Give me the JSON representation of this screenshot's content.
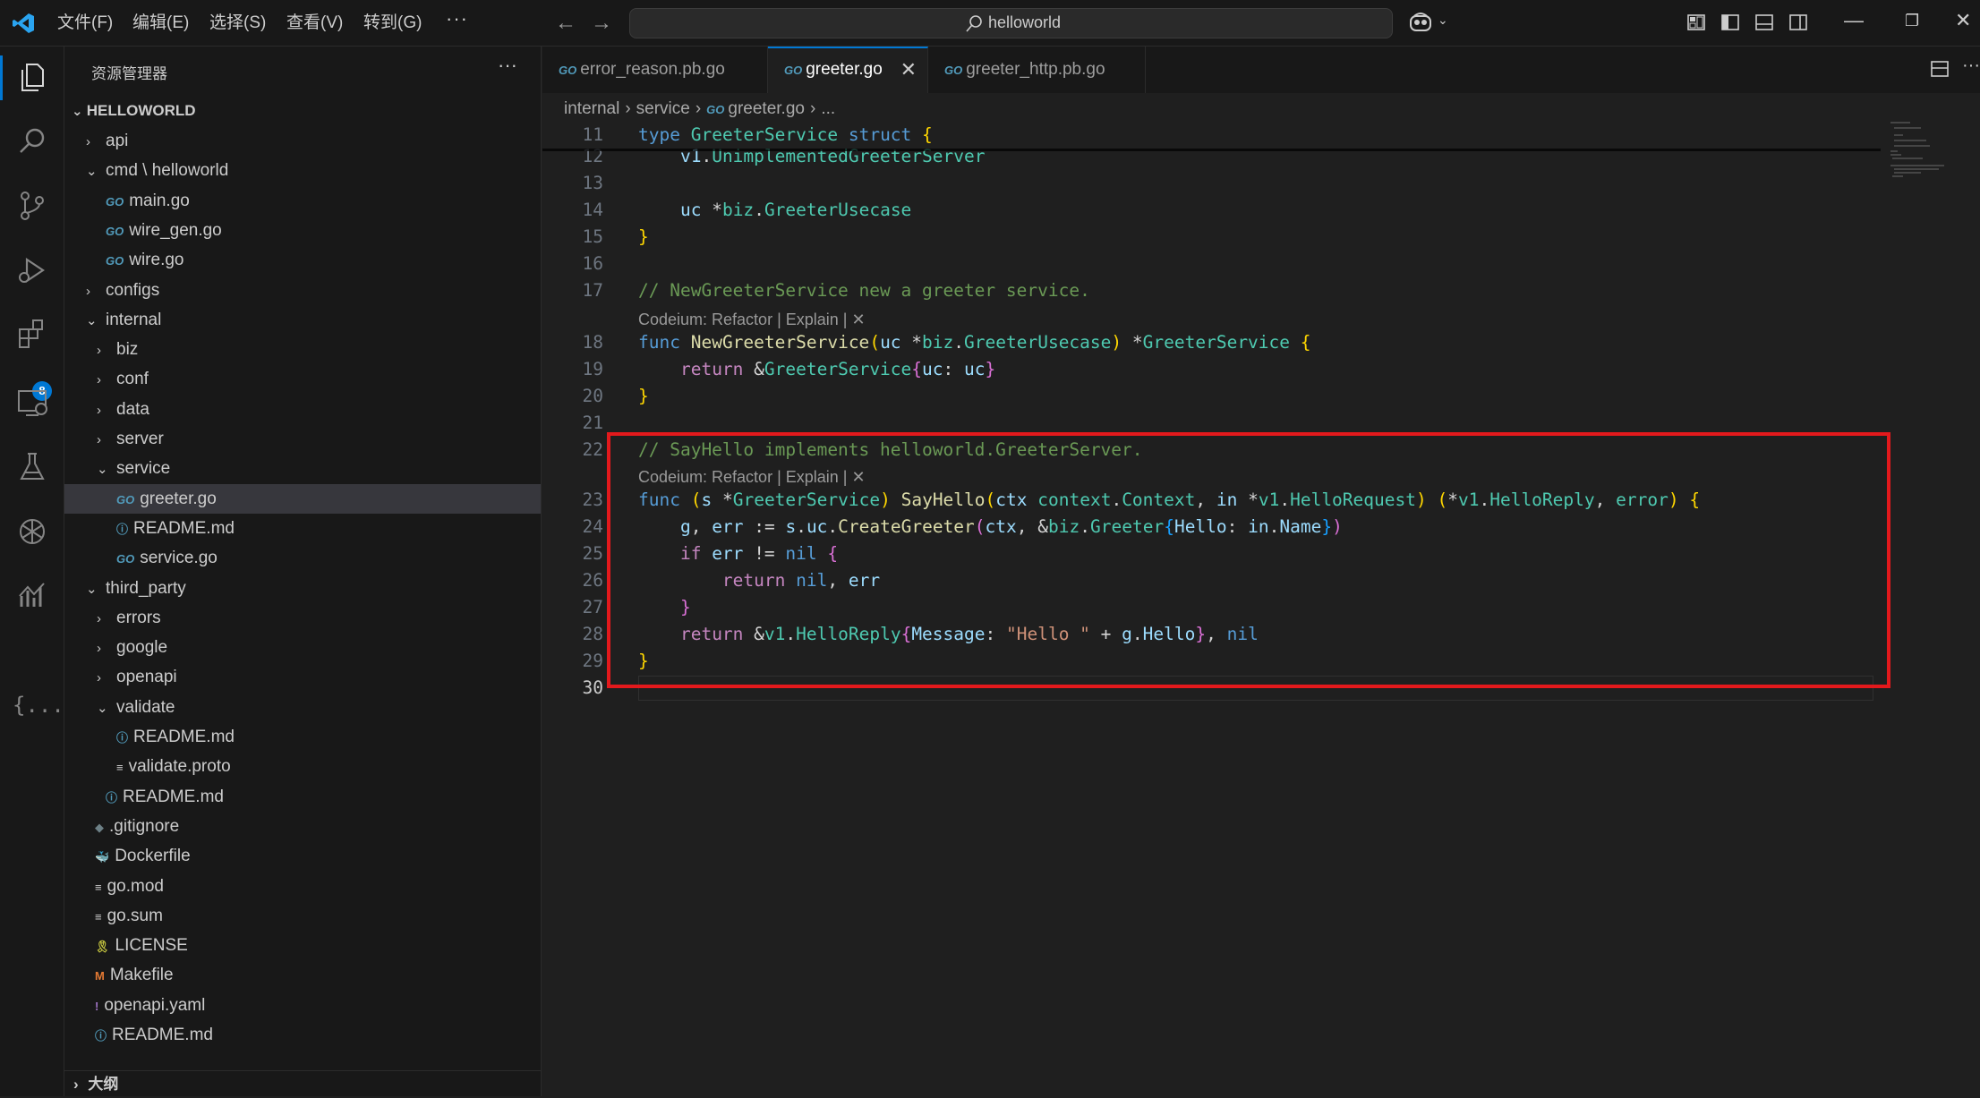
{
  "titlebar": {
    "menus": [
      "文件(F)",
      "编辑(E)",
      "选择(S)",
      "查看(V)",
      "转到(G)"
    ],
    "more": "···",
    "search": "helloworld"
  },
  "activity": {
    "extensions_badge": "8",
    "json_icon": "{...}"
  },
  "sidebar": {
    "title": "资源管理器",
    "more": "···",
    "project": "HELLOWORLD",
    "outline": "大纲",
    "tree": [
      {
        "label": "api",
        "chev": "›",
        "indent": 0,
        "icon": ""
      },
      {
        "label": "cmd \\ helloworld",
        "chev": "⌄",
        "indent": 0,
        "icon": ""
      },
      {
        "label": "main.go",
        "chev": "",
        "indent": 1,
        "icon": "go"
      },
      {
        "label": "wire_gen.go",
        "chev": "",
        "indent": 1,
        "icon": "go"
      },
      {
        "label": "wire.go",
        "chev": "",
        "indent": 1,
        "icon": "go"
      },
      {
        "label": "configs",
        "chev": "›",
        "indent": 0,
        "icon": ""
      },
      {
        "label": "internal",
        "chev": "⌄",
        "indent": 0,
        "icon": ""
      },
      {
        "label": "biz",
        "chev": "›",
        "indent": 1,
        "icon": ""
      },
      {
        "label": "conf",
        "chev": "›",
        "indent": 1,
        "icon": ""
      },
      {
        "label": "data",
        "chev": "›",
        "indent": 1,
        "icon": ""
      },
      {
        "label": "server",
        "chev": "›",
        "indent": 1,
        "icon": ""
      },
      {
        "label": "service",
        "chev": "⌄",
        "indent": 1,
        "icon": ""
      },
      {
        "label": "greeter.go",
        "chev": "",
        "indent": 2,
        "icon": "go",
        "selected": true
      },
      {
        "label": "README.md",
        "chev": "",
        "indent": 2,
        "icon": "info"
      },
      {
        "label": "service.go",
        "chev": "",
        "indent": 2,
        "icon": "go"
      },
      {
        "label": "third_party",
        "chev": "⌄",
        "indent": 0,
        "icon": ""
      },
      {
        "label": "errors",
        "chev": "›",
        "indent": 1,
        "icon": ""
      },
      {
        "label": "google",
        "chev": "›",
        "indent": 1,
        "icon": ""
      },
      {
        "label": "openapi",
        "chev": "›",
        "indent": 1,
        "icon": ""
      },
      {
        "label": "validate",
        "chev": "⌄",
        "indent": 1,
        "icon": ""
      },
      {
        "label": "README.md",
        "chev": "",
        "indent": 2,
        "icon": "info"
      },
      {
        "label": "validate.proto",
        "chev": "",
        "indent": 2,
        "icon": "lines"
      },
      {
        "label": "README.md",
        "chev": "",
        "indent": 1,
        "icon": "info"
      },
      {
        "label": ".gitignore",
        "chev": "",
        "indent": 0,
        "icon": "git"
      },
      {
        "label": "Dockerfile",
        "chev": "",
        "indent": 0,
        "icon": "docker"
      },
      {
        "label": "go.mod",
        "chev": "",
        "indent": 0,
        "icon": "lines"
      },
      {
        "label": "go.sum",
        "chev": "",
        "indent": 0,
        "icon": "lines"
      },
      {
        "label": "LICENSE",
        "chev": "",
        "indent": 0,
        "icon": "license"
      },
      {
        "label": "Makefile",
        "chev": "",
        "indent": 0,
        "icon": "make"
      },
      {
        "label": "openapi.yaml",
        "chev": "",
        "indent": 0,
        "icon": "yaml"
      },
      {
        "label": "README.md",
        "chev": "",
        "indent": 0,
        "icon": "info"
      }
    ]
  },
  "tabs": [
    {
      "label": "error_reason.pb.go",
      "active": false
    },
    {
      "label": "greeter.go",
      "active": true
    },
    {
      "label": "greeter_http.pb.go",
      "active": false
    }
  ],
  "breadcrumb": [
    "internal",
    "service",
    "greeter.go",
    "..."
  ],
  "code_lens": "Codeium: Refactor | Explain | ✕",
  "code": [
    {
      "ln": "11",
      "html": "<span class='k'>type</span> <span class='t'>GreeterService</span> <span class='k'>struct</span> <span class='b1'>{</span>"
    },
    {
      "ln": "12",
      "html": "    <span class='v'>v1</span><span class='p'>.</span><span class='t'>UnimplementedGreeterServer</span>"
    },
    {
      "ln": "13",
      "html": ""
    },
    {
      "ln": "14",
      "html": "    <span class='v'>uc</span> <span class='p'>*</span><span class='t'>biz</span><span class='p'>.</span><span class='t'>GreeterUsecase</span>"
    },
    {
      "ln": "15",
      "html": "<span class='b1'>}</span>"
    },
    {
      "ln": "16",
      "html": ""
    },
    {
      "ln": "17",
      "html": "<span class='c'>// NewGreeterService new a greeter service.</span>"
    },
    {
      "lens": true
    },
    {
      "ln": "18",
      "html": "<span class='k'>func</span> <span class='f'>NewGreeterService</span><span class='b1'>(</span><span class='v'>uc</span> <span class='p'>*</span><span class='t'>biz</span><span class='p'>.</span><span class='t'>GreeterUsecase</span><span class='b1'>)</span> <span class='p'>*</span><span class='t'>GreeterService</span> <span class='b1'>{</span>"
    },
    {
      "ln": "19",
      "html": "    <span class='kc'>return</span> <span class='p'>&amp;</span><span class='t'>GreeterService</span><span class='b2'>{</span><span class='v'>uc</span><span class='p'>:</span> <span class='v'>uc</span><span class='b2'>}</span>"
    },
    {
      "ln": "20",
      "html": "<span class='b1'>}</span>"
    },
    {
      "ln": "21",
      "html": ""
    },
    {
      "ln": "22",
      "html": "<span class='c'>// SayHello implements helloworld.GreeterServer.</span>"
    },
    {
      "lens": true
    },
    {
      "ln": "23",
      "html": "<span class='k'>func</span> <span class='b1'>(</span><span class='v'>s</span> <span class='p'>*</span><span class='t'>GreeterService</span><span class='b1'>)</span> <span class='f'>SayHello</span><span class='b1'>(</span><span class='v'>ctx</span> <span class='t'>context</span><span class='p'>.</span><span class='t'>Context</span><span class='p'>,</span> <span class='v'>in</span> <span class='p'>*</span><span class='t'>v1</span><span class='p'>.</span><span class='t'>HelloRequest</span><span class='b1'>)</span> <span class='b1'>(</span><span class='p'>*</span><span class='t'>v1</span><span class='p'>.</span><span class='t'>HelloReply</span><span class='p'>,</span> <span class='t'>error</span><span class='b1'>)</span> <span class='b1'>{</span>"
    },
    {
      "ln": "24",
      "html": "    <span class='v'>g</span><span class='p'>,</span> <span class='v'>err</span> <span class='p'>:=</span> <span class='v'>s</span><span class='p'>.</span><span class='v'>uc</span><span class='p'>.</span><span class='f'>CreateGreeter</span><span class='b2'>(</span><span class='v'>ctx</span><span class='p'>,</span> <span class='p'>&amp;</span><span class='t'>biz</span><span class='p'>.</span><span class='t'>Greeter</span><span class='b3'>{</span><span class='v'>Hello</span><span class='p'>:</span> <span class='v'>in</span><span class='p'>.</span><span class='v'>Name</span><span class='b3'>}</span><span class='b2'>)</span>"
    },
    {
      "ln": "25",
      "html": "    <span class='kc'>if</span> <span class='v'>err</span> <span class='p'>!=</span> <span class='k'>nil</span> <span class='b2'>{</span>"
    },
    {
      "ln": "26",
      "html": "        <span class='kc'>return</span> <span class='k'>nil</span><span class='p'>,</span> <span class='v'>err</span>"
    },
    {
      "ln": "27",
      "html": "    <span class='b2'>}</span>"
    },
    {
      "ln": "28",
      "html": "    <span class='kc'>return</span> <span class='p'>&amp;</span><span class='t'>v1</span><span class='p'>.</span><span class='t'>HelloReply</span><span class='b2'>{</span><span class='v'>Message</span><span class='p'>:</span> <span class='s'>\"Hello \"</span> <span class='p'>+</span> <span class='v'>g</span><span class='p'>.</span><span class='v'>Hello</span><span class='b2'>}</span><span class='p'>,</span> <span class='k'>nil</span>"
    },
    {
      "ln": "29",
      "html": "<span class='b1'>}</span>"
    },
    {
      "ln": "30",
      "html": "",
      "current": true
    }
  ]
}
